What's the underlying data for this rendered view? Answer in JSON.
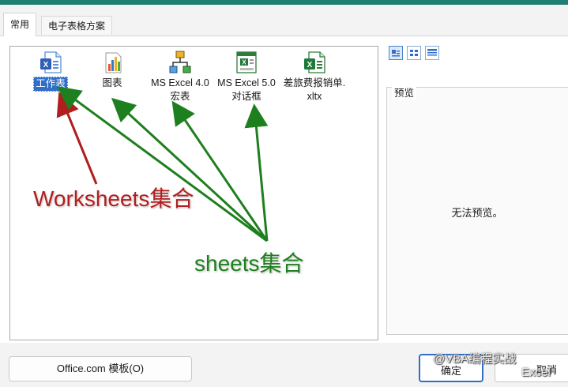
{
  "tabs": [
    {
      "label": "常用",
      "active": true
    },
    {
      "label": "电子表格方案",
      "active": false
    }
  ],
  "templates": [
    {
      "label": "工作表",
      "icon": "excel-worksheet-icon",
      "selected": true
    },
    {
      "label": "图表",
      "icon": "chart-icon",
      "selected": false
    },
    {
      "label": "MS Excel 4.0\n宏表",
      "icon": "macro-sheet-icon",
      "selected": false
    },
    {
      "label": "MS Excel 5.0\n对话框",
      "icon": "dialog-sheet-icon",
      "selected": false
    },
    {
      "label": "差旅费报销单.\nxltx",
      "icon": "excel-template-icon",
      "selected": false
    }
  ],
  "view_buttons": [
    {
      "icon": "large-icons-view-icon",
      "active": true
    },
    {
      "icon": "list-view-icon",
      "active": false
    },
    {
      "icon": "details-view-icon",
      "active": false
    }
  ],
  "preview": {
    "title": "预览",
    "message": "无法预览。"
  },
  "buttons": {
    "office": "Office.com 模板(O)",
    "ok": "确定",
    "cancel": "取消"
  },
  "annotations": {
    "red": "Worksheets集合",
    "green": "sheets集合"
  },
  "watermark": {
    "line1": "@VBA编程实战",
    "line2": "Excel"
  },
  "colors": {
    "accent_bar": "#1e7f72",
    "selection": "#2f6fc9",
    "red_arrow": "#b01e1e",
    "green_arrow": "#1e7f1e"
  }
}
